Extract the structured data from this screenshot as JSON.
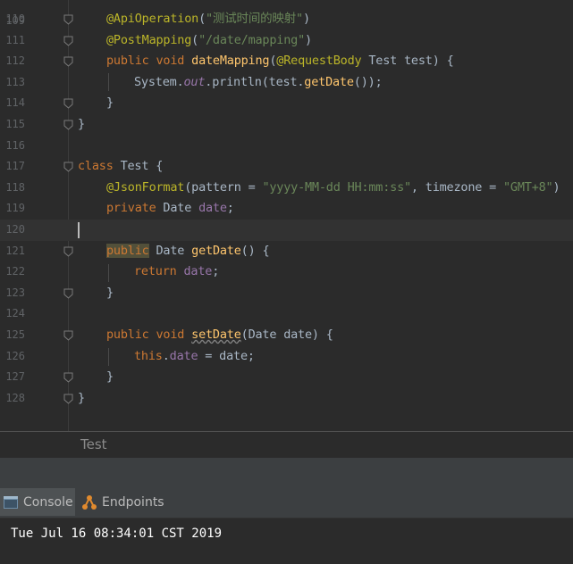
{
  "editor": {
    "top_fragment_number": "109",
    "lines": [
      {
        "n": "110",
        "tokens": [
          [
            "ann",
            "@ApiOperation"
          ],
          [
            "txt",
            "("
          ],
          [
            "str",
            "\"测试时间的映射\""
          ],
          [
            "txt",
            ")"
          ]
        ]
      },
      {
        "n": "111",
        "tokens": [
          [
            "ann",
            "@PostMapping"
          ],
          [
            "txt",
            "("
          ],
          [
            "str",
            "\"/date/mapping\""
          ],
          [
            "txt",
            ")"
          ]
        ]
      },
      {
        "n": "112",
        "tokens": [
          [
            "kw",
            "public "
          ],
          [
            "kw",
            "void "
          ],
          [
            "fn",
            "dateMapping"
          ],
          [
            "txt",
            "("
          ],
          [
            "ann",
            "@RequestBody "
          ],
          [
            "txt",
            "Test test) {"
          ]
        ]
      },
      {
        "n": "113",
        "tokens": [
          [
            "txt",
            "System."
          ],
          [
            "static",
            "out"
          ],
          [
            "txt",
            "."
          ],
          [
            "txt",
            "println(test."
          ],
          [
            "fn",
            "getDate"
          ],
          [
            "txt",
            "());"
          ]
        ]
      },
      {
        "n": "114",
        "tokens": [
          [
            "txt",
            "}"
          ]
        ]
      },
      {
        "n": "115",
        "tokens": [
          [
            "txt",
            "}"
          ]
        ]
      },
      {
        "n": "116",
        "tokens": []
      },
      {
        "n": "117",
        "tokens": [
          [
            "kw",
            "class "
          ],
          [
            "txt",
            "Test {"
          ]
        ]
      },
      {
        "n": "118",
        "tokens": [
          [
            "ann",
            "@JsonFormat"
          ],
          [
            "txt",
            "(pattern = "
          ],
          [
            "str",
            "\"yyyy-MM-dd HH:mm:ss\""
          ],
          [
            "txt",
            ", timezone = "
          ],
          [
            "str",
            "\"GMT+8\""
          ],
          [
            "txt",
            ")"
          ]
        ]
      },
      {
        "n": "119",
        "tokens": [
          [
            "kw",
            "private "
          ],
          [
            "txt",
            "Date "
          ],
          [
            "fld",
            "date"
          ],
          [
            "txt",
            ";"
          ]
        ]
      },
      {
        "n": "120",
        "tokens": []
      },
      {
        "n": "121",
        "tokens": [
          [
            "kwhl",
            "public"
          ],
          [
            "txt",
            " Date "
          ],
          [
            "fn",
            "getDate"
          ],
          [
            "txt",
            "() {"
          ]
        ]
      },
      {
        "n": "122",
        "tokens": [
          [
            "kw",
            "return "
          ],
          [
            "fld",
            "date"
          ],
          [
            "txt",
            ";"
          ]
        ]
      },
      {
        "n": "123",
        "tokens": [
          [
            "txt",
            "}"
          ]
        ]
      },
      {
        "n": "124",
        "tokens": []
      },
      {
        "n": "125",
        "tokens": [
          [
            "kw",
            "public "
          ],
          [
            "kw",
            "void "
          ],
          [
            "sq",
            "setDate"
          ],
          [
            "txt",
            "(Date date) {"
          ]
        ]
      },
      {
        "n": "126",
        "tokens": [
          [
            "kw",
            "this"
          ],
          [
            "txt",
            "."
          ],
          [
            "fld",
            "date"
          ],
          [
            "txt",
            " = date;"
          ]
        ]
      },
      {
        "n": "127",
        "tokens": [
          [
            "txt",
            "}"
          ]
        ]
      },
      {
        "n": "128",
        "tokens": [
          [
            "txt",
            "}"
          ]
        ]
      }
    ]
  },
  "breadcrumb": {
    "label": "Test"
  },
  "tool_tabs": [
    {
      "label": "Console",
      "icon": "console-icon",
      "active": true
    },
    {
      "label": "Endpoints",
      "icon": "endpoints-icon",
      "active": false
    }
  ],
  "console": {
    "output": "Tue Jul 16 08:34:01 CST 2019"
  },
  "colors": {
    "background": "#2b2b2b",
    "keyword": "#cc7832",
    "annotation": "#bbb529",
    "string": "#6a8759",
    "method": "#ffc66d",
    "field": "#9876aa",
    "text": "#a9b7c6"
  }
}
